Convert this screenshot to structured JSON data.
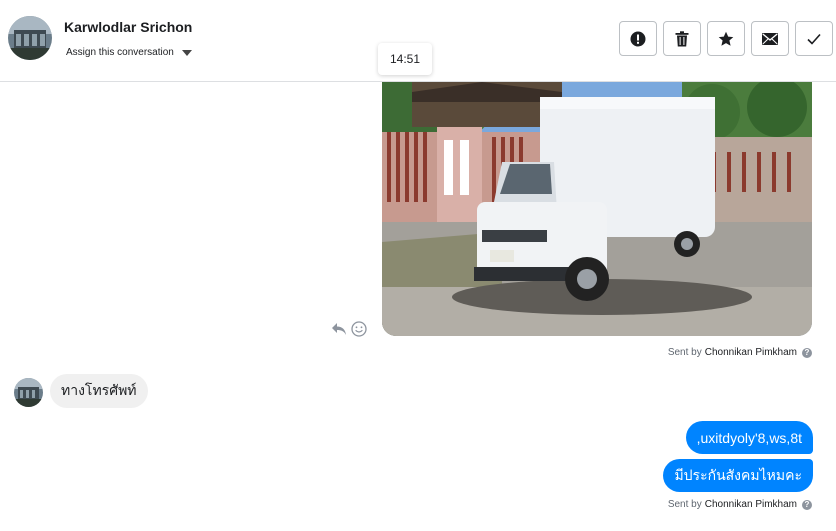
{
  "header": {
    "contact_name": "Karwlodlar Srichon",
    "assign_label": "Assign this conversation",
    "actions": [
      {
        "name": "mark-spam-button",
        "icon": "exclamation-circle-icon"
      },
      {
        "name": "delete-button",
        "icon": "trash-icon"
      },
      {
        "name": "star-button",
        "icon": "star-icon"
      },
      {
        "name": "mark-unread-button",
        "icon": "envelope-icon"
      },
      {
        "name": "mark-done-button",
        "icon": "checkmark-icon"
      }
    ]
  },
  "thread": {
    "timestamp": "14:51",
    "image_message": {
      "icons": [
        "reply-icon",
        "emoji-icon"
      ]
    },
    "sent_by_prefix": "Sent by",
    "sent_by_name": "Chonnikan Pimkham",
    "incoming_message": "ทางโทรศัพท์",
    "outgoing_messages": [
      ",uxitdyoly'8,ws,8t",
      "มีประกันสังคมไหมคะ"
    ],
    "sent_by_prefix_2": "Sent by",
    "sent_by_name_2": "Chonnikan Pimkham"
  },
  "colors": {
    "outgoing_bubble": "#0084ff",
    "incoming_bubble": "#f0f0f0",
    "border": "#bcc0c4"
  }
}
